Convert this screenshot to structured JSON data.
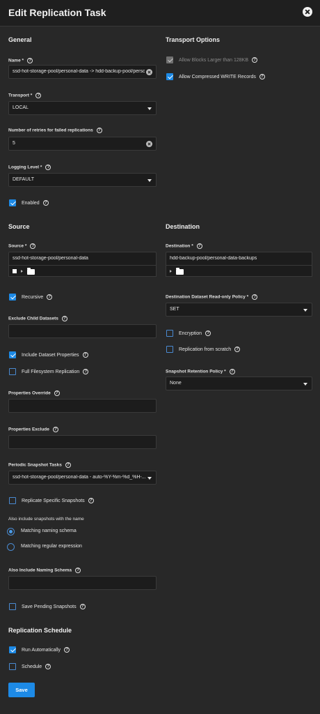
{
  "header": {
    "title": "Edit Replication Task"
  },
  "general": {
    "section_title": "General",
    "name_label": "Name *",
    "name_value": "ssd-hot-storage-pool/personal-data -> hdd-backup-pool/perso",
    "transport_label": "Transport *",
    "transport_value": "LOCAL",
    "retries_label": "Number of retries for failed replications",
    "retries_value": "5",
    "logging_label": "Logging Level *",
    "logging_value": "DEFAULT",
    "enabled_label": "Enabled"
  },
  "transport_options": {
    "section_title": "Transport Options",
    "large_blocks_label": "Allow Blocks Larger than 128KB",
    "compressed_label": "Allow Compressed WRITE Records"
  },
  "source": {
    "section_title": "Source",
    "source_label": "Source *",
    "source_value": "ssd-hot-storage-pool/personal-data",
    "recursive_label": "Recursive",
    "exclude_label": "Exclude Child Datasets",
    "include_props_label": "Include Dataset Properties",
    "full_fs_label": "Full Filesystem Replication",
    "props_override_label": "Properties Override",
    "props_exclude_label": "Properties Exclude",
    "periodic_label": "Periodic Snapshot Tasks",
    "periodic_value": "ssd-hot-storage-pool/personal-data - auto-%Y-%m-%d_%H-...",
    "replicate_specific_label": "Replicate Specific Snapshots",
    "also_include_text": "Also include snapshots with the name",
    "matching_schema_label": "Matching naming schema",
    "matching_regex_label": "Matching regular expression",
    "also_naming_label": "Also Include Naming Schema",
    "save_pending_label": "Save Pending Snapshots"
  },
  "destination": {
    "section_title": "Destination",
    "dest_label": "Destination *",
    "dest_value": "hdd-backup-pool/personal-data-backups",
    "readonly_label": "Destination Dataset Read-only Policy *",
    "readonly_value": "SET",
    "encryption_label": "Encryption",
    "scratch_label": "Replication from scratch",
    "retention_label": "Snapshot Retention Policy *",
    "retention_value": "None"
  },
  "schedule": {
    "section_title": "Replication Schedule",
    "run_auto_label": "Run Automatically",
    "schedule_label": "Schedule"
  },
  "actions": {
    "save_label": "Save"
  },
  "icons": {
    "help": "help-circle-icon",
    "close": "close-icon",
    "folder": "folder-icon"
  },
  "colors": {
    "accent": "#1d8ae6",
    "background": "#282828",
    "field": "#1c1c1c"
  }
}
